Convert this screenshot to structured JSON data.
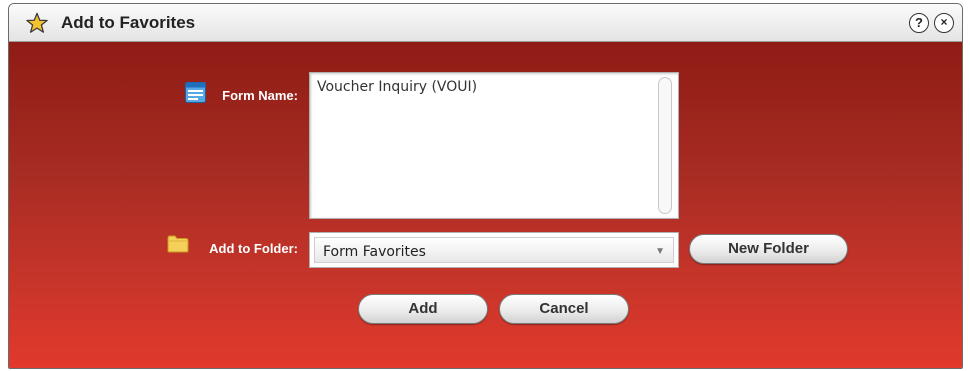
{
  "dialog": {
    "title": "Add to Favorites",
    "help_glyph": "?",
    "close_glyph": "×"
  },
  "form": {
    "form_name_label": "Form Name:",
    "form_name_value": "Voucher Inquiry (VOUI)",
    "folder_label": "Add to Folder:",
    "folder_selected": "Form Favorites",
    "new_folder_label": "New Folder"
  },
  "buttons": {
    "add": "Add",
    "cancel": "Cancel"
  },
  "icons": {
    "title": "star-icon",
    "form": "form-icon",
    "folder": "folder-icon",
    "help": "help-icon",
    "close": "close-icon",
    "dropdown": "chevron-down-icon"
  },
  "colors": {
    "body_top": "#8e1c15",
    "body_bottom": "#e2392c",
    "star": "#f2c230"
  }
}
